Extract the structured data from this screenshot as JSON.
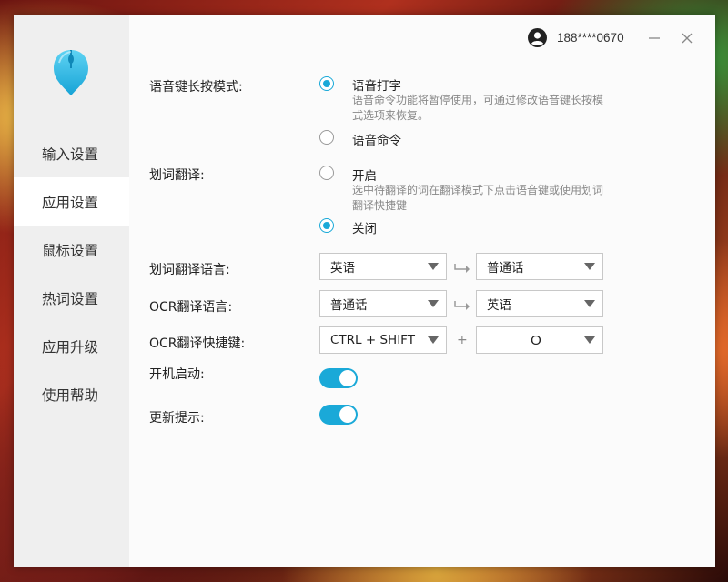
{
  "user": {
    "account": "188****0670"
  },
  "sidebar": {
    "items": [
      {
        "label": "输入设置",
        "active": false
      },
      {
        "label": "应用设置",
        "active": true
      },
      {
        "label": "鼠标设置",
        "active": false
      },
      {
        "label": "热词设置",
        "active": false
      },
      {
        "label": "应用升级",
        "active": false
      },
      {
        "label": "使用帮助",
        "active": false
      }
    ]
  },
  "settings": {
    "voice_key_mode": {
      "label": "语音键长按模式:",
      "option1": {
        "label": "语音打字",
        "desc": "语音命令功能将暂停使用，可通过修改语音键长按模式选项来恢复。",
        "checked": true
      },
      "option2": {
        "label": "语音命令",
        "checked": false
      }
    },
    "word_translate": {
      "label": "划词翻译:",
      "option1": {
        "label": "开启",
        "desc": "选中待翻译的词在翻译模式下点击语音键或使用划词翻译快捷键",
        "checked": false
      },
      "option2": {
        "label": "关闭",
        "checked": true
      }
    },
    "word_translate_lang": {
      "label": "划词翻译语言:",
      "from": "英语",
      "to": "普通话"
    },
    "ocr_translate_lang": {
      "label": "OCR翻译语言:",
      "from": "普通话",
      "to": "英语"
    },
    "ocr_shortcut": {
      "label": "OCR翻译快捷键:",
      "modifier": "CTRL + SHIFT",
      "plus": "+",
      "key": "O"
    },
    "autostart": {
      "label": "开机启动:",
      "on": true
    },
    "update_tip": {
      "label": "更新提示:",
      "on": true
    }
  },
  "colors": {
    "accent": "#1aa9d8",
    "sidebar_bg": "#efefef"
  },
  "icons": {
    "logo": "mouse-logo-icon",
    "user": "user-avatar-icon",
    "minimize": "minimize-icon",
    "close": "close-icon",
    "swap": "arrow-right-icon"
  }
}
